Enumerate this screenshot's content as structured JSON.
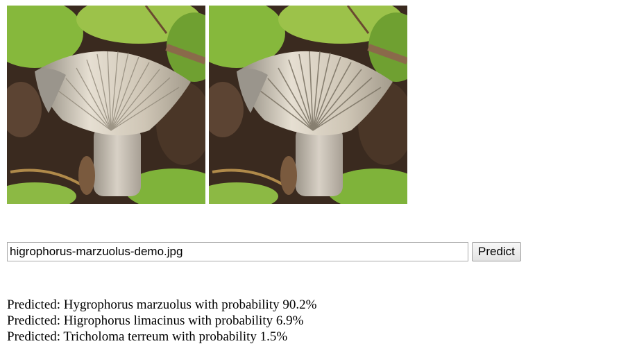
{
  "images": [
    {
      "icon": "mushroom-photo",
      "label": ""
    },
    {
      "icon": "mushroom-photo",
      "label": ""
    }
  ],
  "form": {
    "file_value": "higrophorus-marzuolus-demo.jpg",
    "predict_label": "Predict"
  },
  "predictions": [
    {
      "text": "Predicted: Hygrophorus marzuolus with probability 90.2%",
      "probability": 90.2
    },
    {
      "text": "Predicted: Higrophorus limacinus with probability 6.9%",
      "probability": 6.9
    },
    {
      "text": "Predicted: Tricholoma terreum with probability 1.5%",
      "probability": 1.5
    }
  ],
  "colors": {
    "moss": "#7fb33a",
    "soil": "#3b2a1e",
    "gills": "#d9d1c2",
    "stem": "#c8c0b4"
  }
}
